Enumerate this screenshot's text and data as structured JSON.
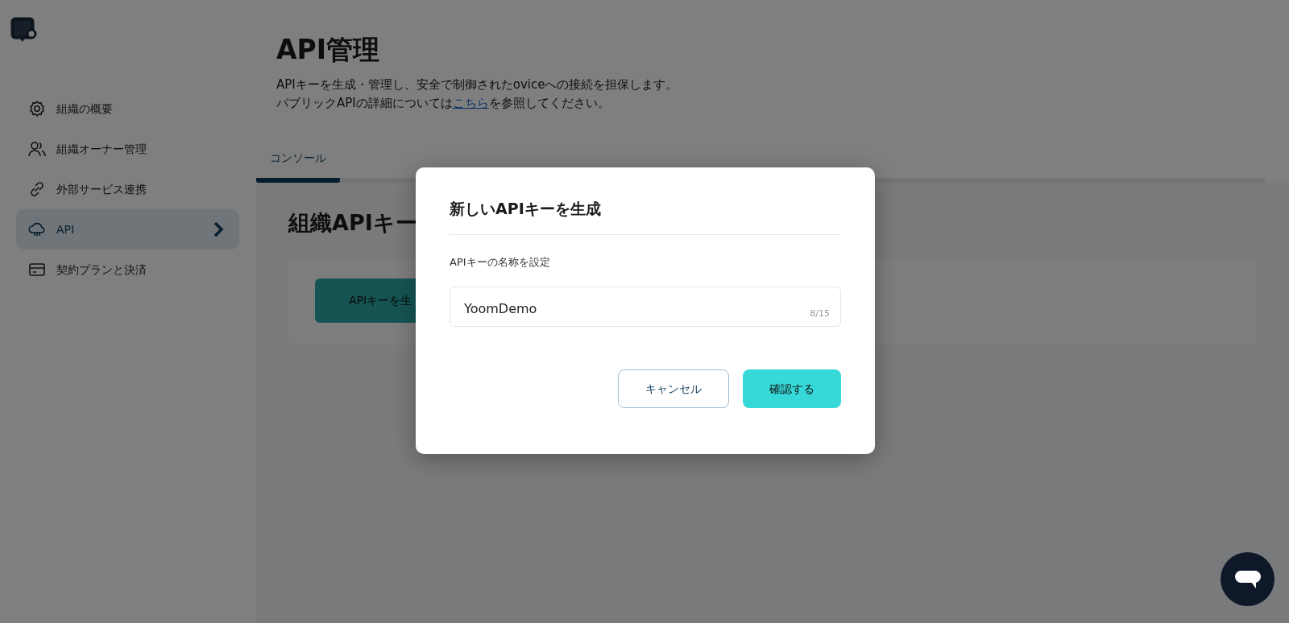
{
  "sidebar": {
    "items": [
      {
        "label": "組織の概要",
        "kind": "gear",
        "selected": false
      },
      {
        "label": "組織オーナー管理",
        "kind": "people",
        "selected": false
      },
      {
        "label": "外部サービス連携",
        "kind": "link",
        "selected": false
      },
      {
        "label": "API",
        "kind": "cloud",
        "selected": true
      },
      {
        "label": "契約プランと決済",
        "kind": "card",
        "selected": false
      }
    ]
  },
  "page": {
    "title": "API管理",
    "description_line1": "APIキーを生成・管理し、安全で制御されたoviceへの接続を担保します。",
    "description_line2_before": "パブリックAPIの詳細については",
    "description_link": "こちら",
    "description_line2_after": "を参照してください。"
  },
  "tabs": [
    {
      "label": "コンソール",
      "selected": true
    }
  ],
  "section": {
    "title": "組織APIキー",
    "button": "APIキーを生"
  },
  "dialog": {
    "title": "新しいAPIキーを生成",
    "field_label": "APIキーの名称を設定",
    "field_value": "YoomDemo",
    "counter": "8/15",
    "cancel_button": "キャンセル",
    "confirm_button": "確認する"
  }
}
